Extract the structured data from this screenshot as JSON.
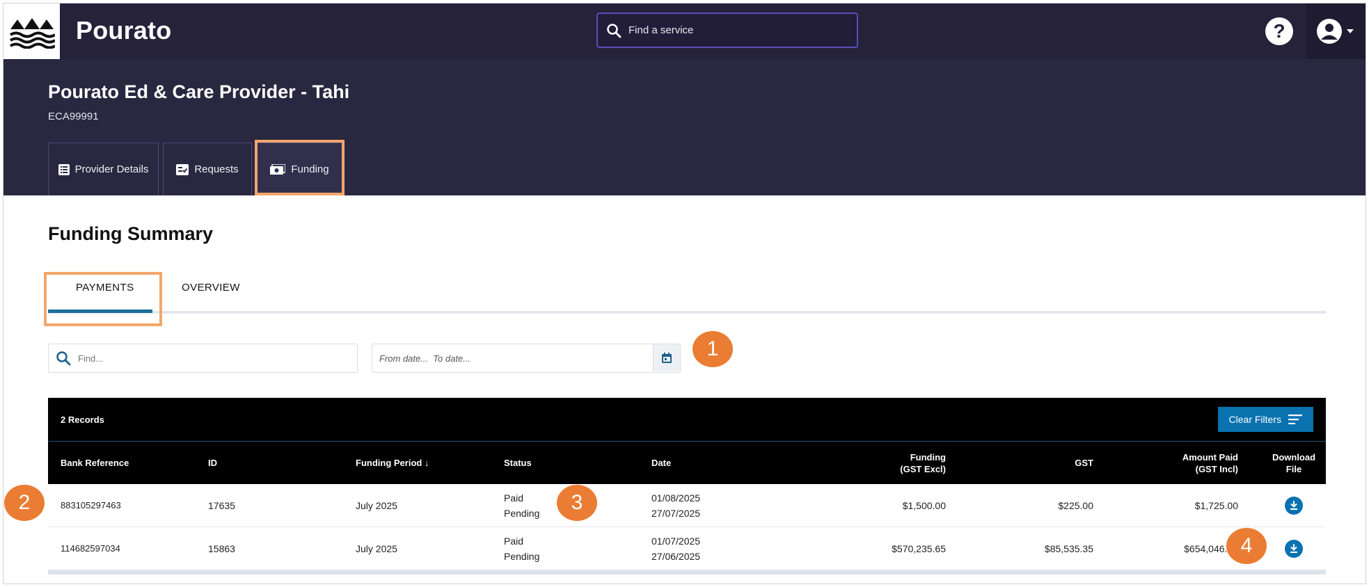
{
  "app": {
    "brand": "Pourato",
    "search_placeholder": "Find a service",
    "help_label": "?"
  },
  "provider": {
    "name": "Pourato Ed & Care Provider - Tahi",
    "id": "ECA99991"
  },
  "tabs": [
    {
      "label": "Provider Details",
      "icon": "list-icon"
    },
    {
      "label": "Requests",
      "icon": "checklist-icon"
    },
    {
      "label": "Funding",
      "icon": "money-icon"
    }
  ],
  "summary": {
    "title": "Funding Summary",
    "subtabs": [
      "PAYMENTS",
      "OVERVIEW"
    ],
    "find_placeholder": "Find...",
    "date_placeholder": "From date...  To date..."
  },
  "markers": [
    "1",
    "2",
    "3",
    "4"
  ],
  "table": {
    "records_label": "2 Records",
    "clear_filters_label": "Clear Filters",
    "columns": {
      "bank_reference": "Bank Reference",
      "id": "ID",
      "funding_period": "Funding Period ↓",
      "status": "Status",
      "date": "Date",
      "funding_line1": "Funding",
      "funding_line2": "(GST Excl)",
      "gst": "GST",
      "amount_line1": "Amount Paid",
      "amount_line2": "(GST Incl)",
      "download_line1": "Download",
      "download_line2": "File"
    },
    "rows": [
      {
        "bank_reference": "883105297463",
        "id": "17635",
        "funding_period": "July 2025",
        "status1": "Paid",
        "status2": "Pending",
        "date1": "01/08/2025",
        "date2": "27/07/2025",
        "funding": "$1,500.00",
        "gst": "$225.00",
        "amount_paid": "$1,725.00"
      },
      {
        "bank_reference": "114682597034",
        "id": "15863",
        "funding_period": "July 2025",
        "status1": "Paid",
        "status2": "Pending",
        "date1": "01/07/2025",
        "date2": "27/06/2025",
        "funding": "$570,235.65",
        "gst": "$85,535.35",
        "amount_paid": "$654,046.00"
      }
    ]
  },
  "colors": {
    "topbar": "#25223a",
    "header_band": "#2a2740",
    "accent_blue": "#0b72b0",
    "highlight_orange": "#f3a66a",
    "marker_orange": "#ea7d33"
  }
}
